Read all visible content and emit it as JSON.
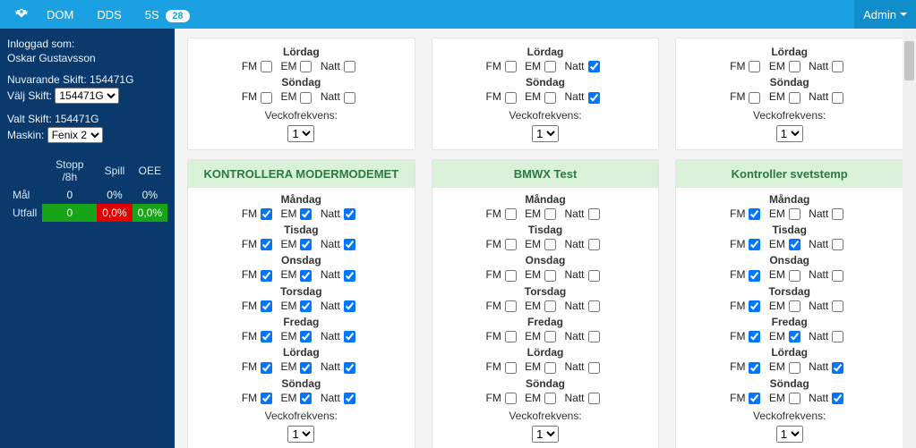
{
  "topnav": {
    "links": [
      "DOM",
      "DDS",
      "5S"
    ],
    "badge": "28",
    "admin": "Admin"
  },
  "sidebar": {
    "loggedin_label": "Inloggad som:",
    "user": "Oskar Gustavsson",
    "current_shift_label": "Nuvarande Skift: 154471G",
    "select_shift_label": "Välj Skift:",
    "select_shift_value": "154471G",
    "selected_shift_label": "Valt Skift: 154471G",
    "machine_label": "Maskin:",
    "machine_value": "Fenix 2",
    "stats": {
      "cols": [
        "Stopp /8h",
        "Spill",
        "OEE"
      ],
      "rows": [
        {
          "label": "Mål",
          "cells": [
            {
              "v": "0",
              "cls": ""
            },
            {
              "v": "0%",
              "cls": ""
            },
            {
              "v": "0%",
              "cls": ""
            }
          ]
        },
        {
          "label": "Utfall",
          "cells": [
            {
              "v": "0",
              "cls": "cell-greenrow"
            },
            {
              "v": "0,0%",
              "cls": "cell-red"
            },
            {
              "v": "0,0%",
              "cls": "cell-green"
            }
          ]
        }
      ]
    }
  },
  "labels": {
    "FM": "FM",
    "EM": "EM",
    "Natt": "Natt",
    "freq": "Veckofrekvens:",
    "freq_val": "1"
  },
  "days_full": [
    "Måndag",
    "Tisdag",
    "Onsdag",
    "Torsdag",
    "Fredag",
    "Lördag",
    "Söndag"
  ],
  "top_cards": [
    {
      "days": [
        {
          "name": "Lördag",
          "fm": false,
          "em": false,
          "natt": false
        },
        {
          "name": "Söndag",
          "fm": false,
          "em": false,
          "natt": false
        }
      ]
    },
    {
      "days": [
        {
          "name": "Lördag",
          "fm": false,
          "em": false,
          "natt": true
        },
        {
          "name": "Söndag",
          "fm": false,
          "em": false,
          "natt": true
        }
      ]
    },
    {
      "days": [
        {
          "name": "Lördag",
          "fm": false,
          "em": false,
          "natt": false
        },
        {
          "name": "Söndag",
          "fm": false,
          "em": false,
          "natt": false
        }
      ]
    }
  ],
  "bottom_cards": [
    {
      "title": "KONTROLLERA MODERMODEMET",
      "days": [
        {
          "name": "Måndag",
          "fm": true,
          "em": true,
          "natt": true
        },
        {
          "name": "Tisdag",
          "fm": true,
          "em": true,
          "natt": true
        },
        {
          "name": "Onsdag",
          "fm": true,
          "em": true,
          "natt": true
        },
        {
          "name": "Torsdag",
          "fm": true,
          "em": true,
          "natt": true
        },
        {
          "name": "Fredag",
          "fm": true,
          "em": true,
          "natt": true
        },
        {
          "name": "Lördag",
          "fm": true,
          "em": true,
          "natt": true
        },
        {
          "name": "Söndag",
          "fm": true,
          "em": true,
          "natt": true
        }
      ]
    },
    {
      "title": "BMWX Test",
      "days": [
        {
          "name": "Måndag",
          "fm": false,
          "em": false,
          "natt": false
        },
        {
          "name": "Tisdag",
          "fm": false,
          "em": false,
          "natt": false
        },
        {
          "name": "Onsdag",
          "fm": false,
          "em": false,
          "natt": false
        },
        {
          "name": "Torsdag",
          "fm": false,
          "em": false,
          "natt": false
        },
        {
          "name": "Fredag",
          "fm": false,
          "em": false,
          "natt": false
        },
        {
          "name": "Lördag",
          "fm": false,
          "em": false,
          "natt": false
        },
        {
          "name": "Söndag",
          "fm": false,
          "em": false,
          "natt": false
        }
      ]
    },
    {
      "title": "Kontroller svetstemp",
      "days": [
        {
          "name": "Måndag",
          "fm": true,
          "em": false,
          "natt": false
        },
        {
          "name": "Tisdag",
          "fm": true,
          "em": true,
          "natt": false
        },
        {
          "name": "Onsdag",
          "fm": true,
          "em": false,
          "natt": false
        },
        {
          "name": "Torsdag",
          "fm": true,
          "em": false,
          "natt": false
        },
        {
          "name": "Fredag",
          "fm": true,
          "em": true,
          "natt": false
        },
        {
          "name": "Lördag",
          "fm": true,
          "em": false,
          "natt": true
        },
        {
          "name": "Söndag",
          "fm": true,
          "em": false,
          "natt": true
        }
      ]
    }
  ]
}
